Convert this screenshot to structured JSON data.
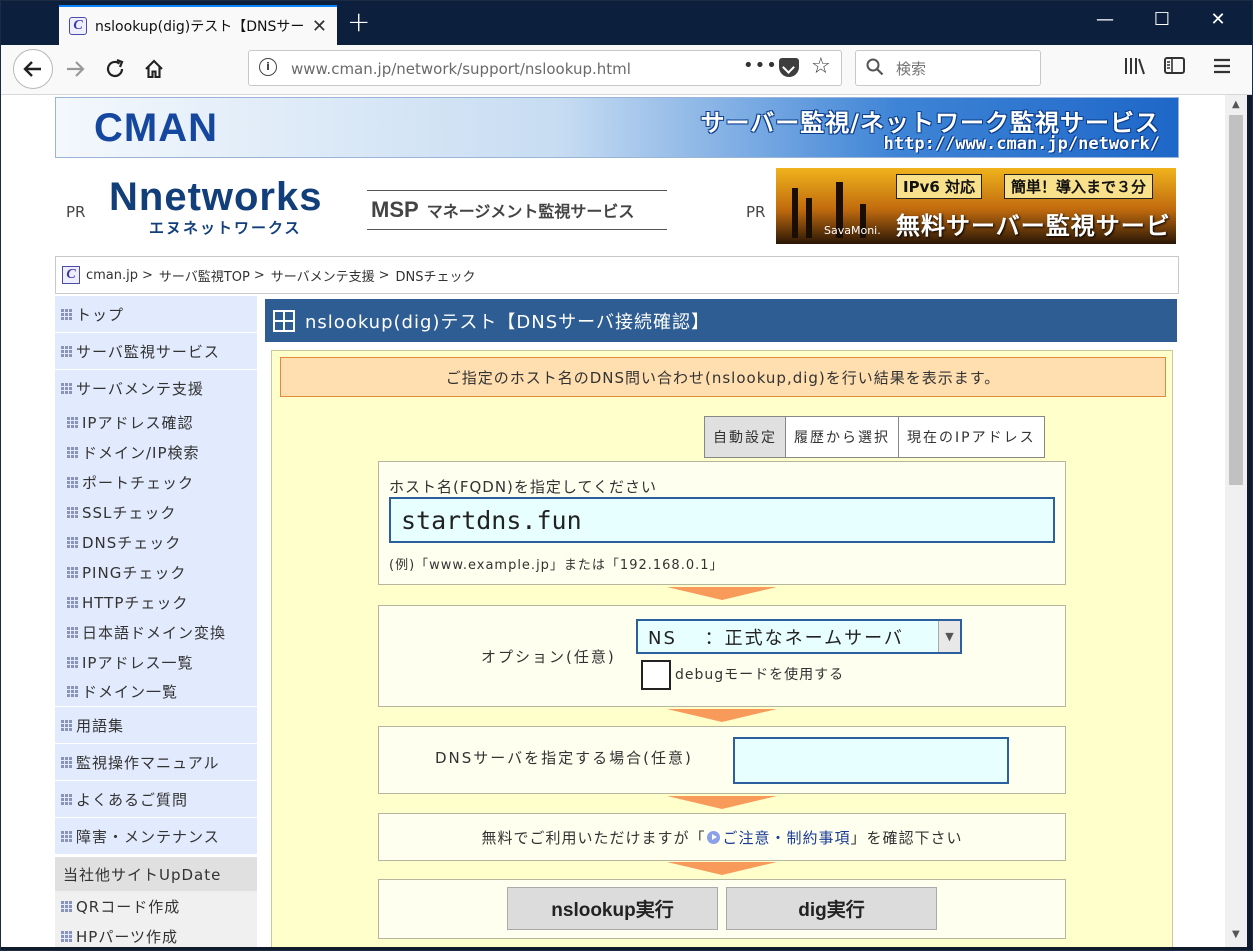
{
  "browser": {
    "tab_title": "nslookup(dig)テスト【DNSサーバ接",
    "tab_favicon": "C",
    "new_tab": "+",
    "url": "www.cman.jp/network/support/nslookup.html",
    "search_placeholder": "検索",
    "controls": {
      "minimize": "—",
      "maximize": "☐",
      "close": "✕"
    }
  },
  "page": {
    "banner": {
      "logo": "CMAN",
      "title": "サーバー監視/ネットワーク監視サービス",
      "url": "http://www.cman.jp/network/"
    },
    "ads": {
      "pr_left": "PR",
      "pr_right": "PR",
      "nnetworks_main": "Nnetworks",
      "nnetworks_kana": "エヌネットワークス",
      "msp_label": "MSP",
      "msp_text": "マネージメント監視サービス",
      "sava_ipv6": "IPv6 対応",
      "sava_easy": "簡単！導入まで３分",
      "sava_free": "無料サーバー監視サービス",
      "sava_brand": "SavaMoni."
    },
    "breadcrumb": {
      "icon": "C",
      "items": [
        "cman.jp",
        "サーバ監視TOP",
        "サーバメンテ支援",
        "DNSチェック"
      ],
      "separator": ">"
    },
    "sidebar": {
      "top": "トップ",
      "monitor_service": "サーバ監視サービス",
      "maintenance": "サーバメンテ支援",
      "sub_items": [
        "IPアドレス確認",
        "ドメイン/IP検索",
        "ポートチェック",
        "SSLチェック",
        "DNSチェック",
        "PINGチェック",
        "HTTPチェック",
        "日本語ドメイン変換",
        "IPアドレス一覧",
        "ドメイン一覧"
      ],
      "glossary": "用語集",
      "manual": "監視操作マニュアル",
      "faq": "よくあるご質問",
      "trouble": "障害・メンテナンス",
      "group_title": "当社他サイトUpDate",
      "qr": "QRコード作成",
      "hp_parts": "HPパーツ作成"
    },
    "main": {
      "title": "nslookup(dig)テスト【DNSサーバ接続確認】",
      "notice": "ご指定のホスト名のDNS問い合わせ(nslookup,dig)を行い結果を表示ます。",
      "mode_tabs": [
        "自動設定",
        "履歴から選択",
        "現在のIPアドレス"
      ],
      "host_label": "ホスト名(FQDN)を指定してください",
      "host_value": "startdns.fun",
      "host_example": "(例)「www.example.jp」または「192.168.0.1」",
      "option_label": "オプション(任意)",
      "option_selected": "NS　 ：正式なネームサーバ",
      "debug_label": "debugモードを使用する",
      "dns_label": "DNSサーバを指定する場合(任意)",
      "dns_value": "",
      "note_prefix": "無料でご利用いただけますが「",
      "note_link": "ご注意・制約事項",
      "note_suffix": "」を確認下さい",
      "nslookup_button": "nslookup実行",
      "dig_button": "dig実行"
    }
  },
  "colors": {
    "tabbar": "#0c1f3d",
    "header_blue": "#2e5d93",
    "form_bg": "#ffffcc",
    "notice_bg": "#ffdeb0",
    "input_bg": "#e7ffff",
    "arrow": "#f79a5a",
    "sidebar_bg": "#e2eafd"
  }
}
